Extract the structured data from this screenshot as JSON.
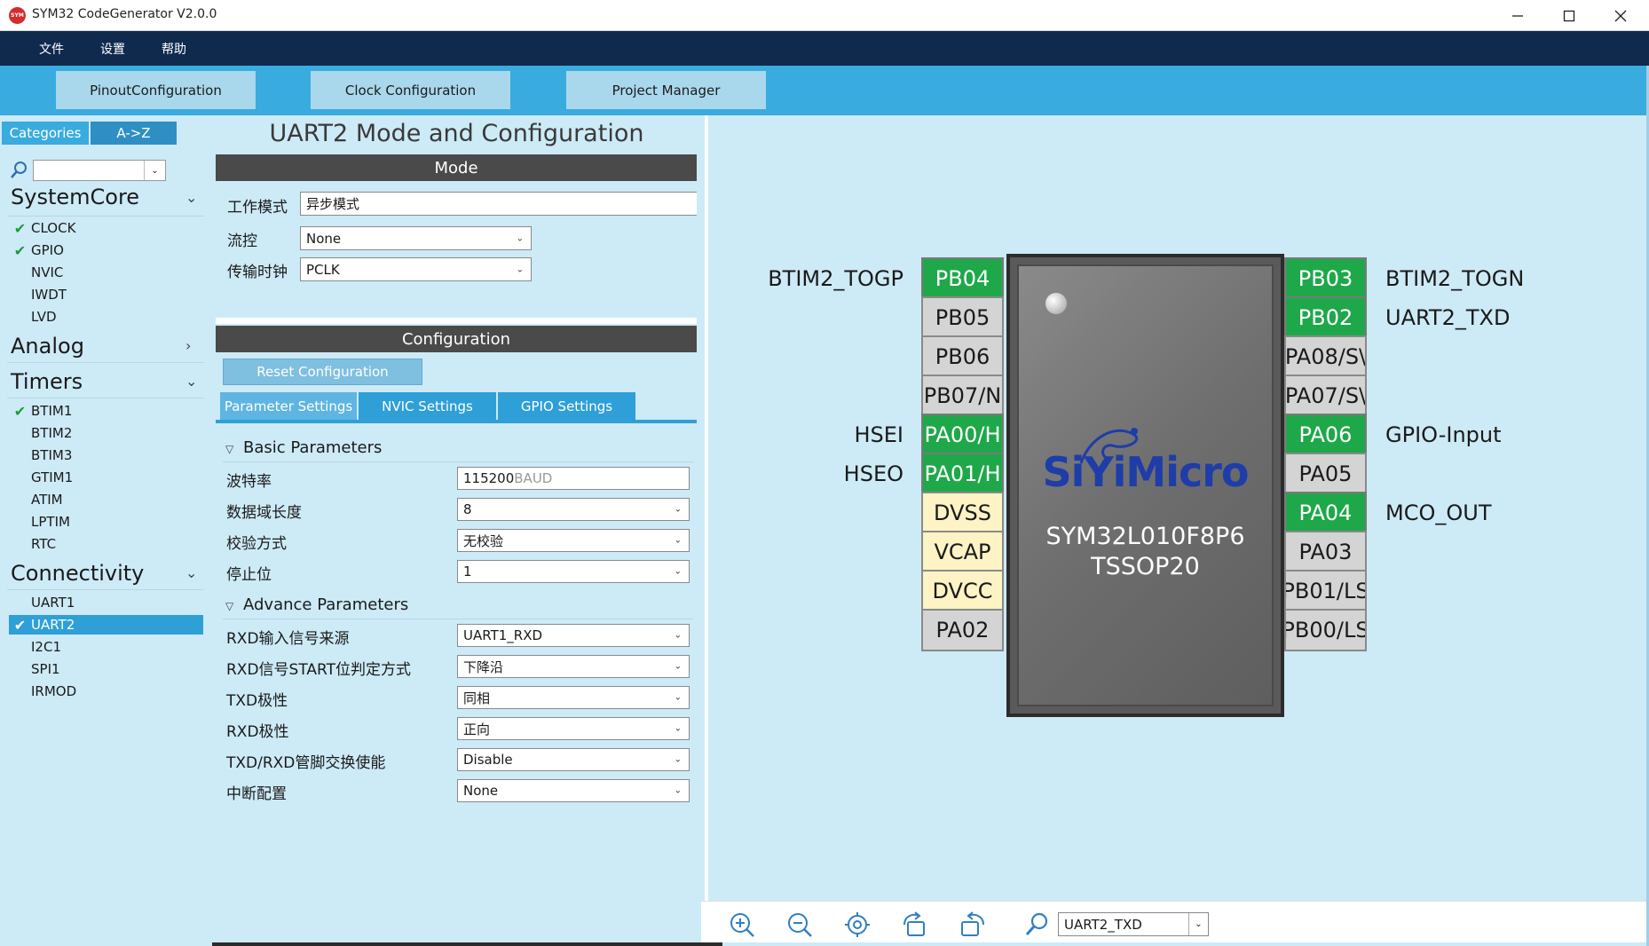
{
  "window": {
    "title": "SYM32 CodeGenerator V2.0.0",
    "icon_text": "SYM"
  },
  "menu": [
    "文件",
    "设置",
    "帮助"
  ],
  "toolbar_tabs": [
    "PinoutConfiguration",
    "Clock Configuration",
    "Project Manager"
  ],
  "left": {
    "tabs": [
      "Categories",
      "A->Z"
    ],
    "search_value": "",
    "groups": {
      "systemcore": {
        "title": "SystemCore",
        "items": [
          {
            "label": "CLOCK",
            "checked": true
          },
          {
            "label": "GPIO",
            "checked": true
          },
          {
            "label": "NVIC",
            "checked": false
          },
          {
            "label": "IWDT",
            "checked": false
          },
          {
            "label": "LVD",
            "checked": false
          }
        ]
      },
      "analog": {
        "title": "Analog"
      },
      "timers": {
        "title": "Timers",
        "items": [
          {
            "label": "BTIM1",
            "checked": true
          },
          {
            "label": "BTIM2",
            "checked": false
          },
          {
            "label": "BTIM3",
            "checked": false
          },
          {
            "label": "GTIM1",
            "checked": false
          },
          {
            "label": "ATIM",
            "checked": false
          },
          {
            "label": "LPTIM",
            "checked": false
          },
          {
            "label": "RTC",
            "checked": false
          }
        ]
      },
      "connectivity": {
        "title": "Connectivity",
        "items": [
          {
            "label": "UART1",
            "checked": false
          },
          {
            "label": "UART2",
            "checked": true,
            "selected": true
          },
          {
            "label": "I2C1",
            "checked": false
          },
          {
            "label": "SPI1",
            "checked": false
          },
          {
            "label": "IRMOD",
            "checked": false
          }
        ]
      }
    }
  },
  "config": {
    "title": "UART2 Mode and Configuration",
    "mode_header": "Mode",
    "mode": {
      "work_mode_label": "工作模式",
      "work_mode_value": "异步模式",
      "flow_label": "流控",
      "flow_value": "None",
      "clock_label": "传输时钟",
      "clock_value": "PCLK"
    },
    "config_header": "Configuration",
    "reset_button": "Reset Configuration",
    "subtabs": [
      "Parameter Settings",
      "NVIC Settings",
      "GPIO Settings"
    ],
    "basic_header": "Basic Parameters",
    "basic": [
      {
        "label": "波特率",
        "value": "115200",
        "unit": "BAUD"
      },
      {
        "label": "数据域长度",
        "value": "8"
      },
      {
        "label": "校验方式",
        "value": "无校验"
      },
      {
        "label": "停止位",
        "value": "1"
      }
    ],
    "advance_header": "Advance Parameters",
    "advance": [
      {
        "label": "RXD输入信号来源",
        "value": "UART1_RXD"
      },
      {
        "label": "RXD信号START位判定方式",
        "value": "下降沿"
      },
      {
        "label": "TXD极性",
        "value": "同相"
      },
      {
        "label": "RXD极性",
        "value": "正向"
      },
      {
        "label": "TXD/RXD管脚交换使能",
        "value": "Disable"
      },
      {
        "label": "中断配置",
        "value": "None"
      }
    ]
  },
  "pinout": {
    "chip_logo": "SiYiMicro",
    "chip_part": "SYM32L010F8P6",
    "chip_package": "TSSOP20",
    "left_pins": [
      {
        "name": "PB04",
        "state": "green",
        "signal": "BTIM2_TOGP"
      },
      {
        "name": "PB05",
        "state": "grey",
        "signal": ""
      },
      {
        "name": "PB06",
        "state": "grey",
        "signal": ""
      },
      {
        "name": "PB07/N",
        "state": "grey",
        "signal": ""
      },
      {
        "name": "PA00/H",
        "state": "green",
        "signal": "HSEI"
      },
      {
        "name": "PA01/H",
        "state": "green",
        "signal": "HSEO"
      },
      {
        "name": "DVSS",
        "state": "yellow",
        "signal": ""
      },
      {
        "name": "VCAP",
        "state": "yellow",
        "signal": ""
      },
      {
        "name": "DVCC",
        "state": "yellow",
        "signal": ""
      },
      {
        "name": "PA02",
        "state": "grey",
        "signal": ""
      }
    ],
    "right_pins": [
      {
        "name": "PB03",
        "state": "green",
        "signal": "BTIM2_TOGN"
      },
      {
        "name": "PB02",
        "state": "green",
        "signal": "UART2_TXD"
      },
      {
        "name": "PA08/S\\",
        "state": "grey",
        "signal": ""
      },
      {
        "name": "PA07/S\\",
        "state": "grey",
        "signal": ""
      },
      {
        "name": "PA06",
        "state": "green",
        "signal": "GPIO-Input"
      },
      {
        "name": "PA05",
        "state": "grey",
        "signal": ""
      },
      {
        "name": "PA04",
        "state": "green",
        "signal": "MCO_OUT"
      },
      {
        "name": "PA03",
        "state": "grey",
        "signal": ""
      },
      {
        "name": "PB01/LS",
        "state": "grey",
        "signal": ""
      },
      {
        "name": "PB00/LS",
        "state": "grey",
        "signal": ""
      }
    ]
  },
  "bottom": {
    "icons": [
      "zoom-in-icon",
      "zoom-out-icon",
      "fit-icon",
      "rotate-right-icon",
      "rotate-left-icon",
      "search-icon"
    ],
    "pin_search_value": "UART2_TXD"
  },
  "colors": {
    "menubar": "#102a4e",
    "toolbar": "#3aabde",
    "panel_bg": "#cdeaf7",
    "pin_green": "#1fa84a",
    "pin_grey": "#d4d4d4",
    "pin_yellow": "#fdf3c4",
    "accent": "#2f9fd8"
  }
}
